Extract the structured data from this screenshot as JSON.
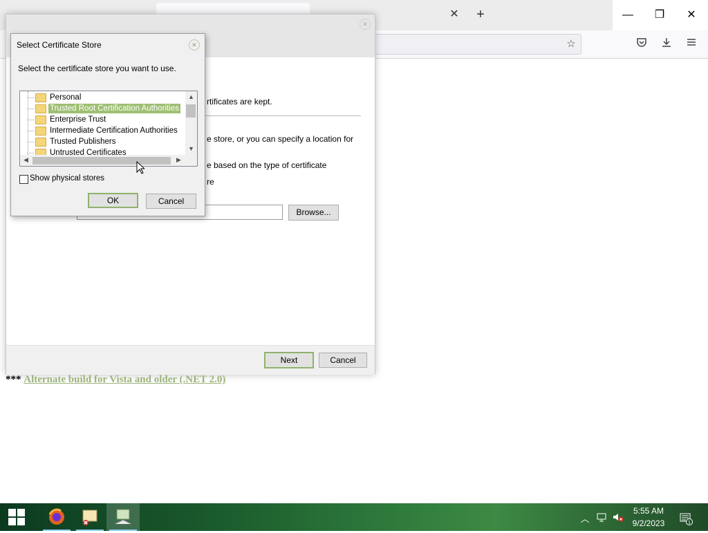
{
  "browser": {
    "tab_close_glyph": "✕",
    "new_tab_glyph": "+",
    "window_controls": {
      "minimize": "—",
      "maximize": "❐",
      "close": "✕"
    },
    "toolbar_icons": [
      "star-icon",
      "pocket-icon",
      "download-icon",
      "menu-icon"
    ]
  },
  "wizard": {
    "line1": "rtificates are kept.",
    "line2": "e store, or you can specify a location for",
    "line3": "e based on the type of certificate",
    "line4": "re",
    "browse_label": "Browse...",
    "next_label": "Next",
    "cancel_label": "Cancel"
  },
  "page": {
    "stars": "***",
    "link_text": "Alternate build for Vista and older (.NET 2.0)"
  },
  "dialog": {
    "title": "Select Certificate Store",
    "prompt": "Select the certificate store you want to use.",
    "stores": [
      "Personal",
      "Trusted Root Certification Authorities",
      "Enterprise Trust",
      "Intermediate Certification Authorities",
      "Trusted Publishers",
      "Untrusted Certificates"
    ],
    "selected_index": 1,
    "show_physical_label": "Show physical stores",
    "show_physical_checked": false,
    "ok_label": "OK",
    "cancel_label": "Cancel"
  },
  "taskbar": {
    "apps": [
      "windows-start",
      "firefox",
      "certmgr",
      "cert-wizard"
    ],
    "time": "5:55 AM",
    "date": "9/2/2023",
    "notification_count": "1"
  },
  "colors": {
    "accent": "#9ebf73",
    "link": "#9cb37c",
    "default_button_border": "#8fb26b"
  }
}
